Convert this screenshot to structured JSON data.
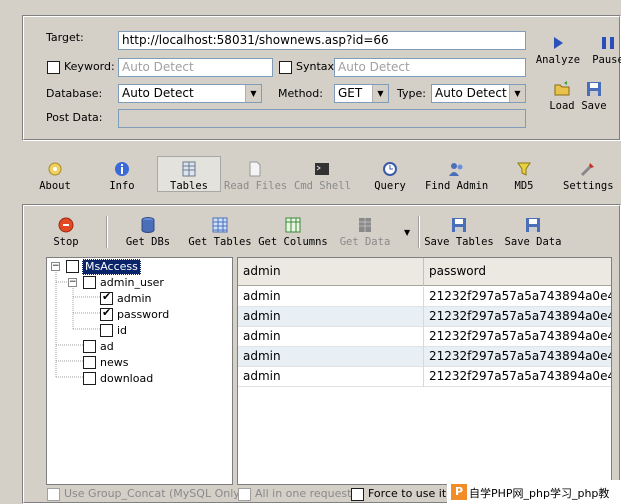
{
  "form": {
    "target_label": "Target:",
    "target_value": "http://localhost:58031/shownews.asp?id=66",
    "keyword_label": "Keyword:",
    "keyword_placeholder": "Auto Detect",
    "syntax_label": "Syntax:",
    "syntax_placeholder": "Auto Detect",
    "database_label": "Database:",
    "database_value": "Auto Detect",
    "method_label": "Method:",
    "method_value": "GET",
    "type_label": "Type:",
    "type_value": "Auto Detect",
    "postdata_label": "Post Data:"
  },
  "side_actions": {
    "analyze": "Analyze",
    "pause": "Pause",
    "load": "Load",
    "save": "Save"
  },
  "main_toolbar": [
    {
      "label": "About",
      "icon": "about-icon",
      "state": "normal"
    },
    {
      "label": "Info",
      "icon": "info-icon",
      "state": "normal"
    },
    {
      "label": "Tables",
      "icon": "tables-icon",
      "state": "active"
    },
    {
      "label": "Read Files",
      "icon": "read-files-icon",
      "state": "disabled"
    },
    {
      "label": "Cmd Shell",
      "icon": "cmd-shell-icon",
      "state": "disabled"
    },
    {
      "label": "Query",
      "icon": "query-icon",
      "state": "normal"
    },
    {
      "label": "Find Admin",
      "icon": "find-admin-icon",
      "state": "normal"
    },
    {
      "label": "MD5",
      "icon": "md5-icon",
      "state": "normal"
    },
    {
      "label": "Settings",
      "icon": "settings-icon",
      "state": "normal"
    }
  ],
  "sub_toolbar": {
    "stop": "Stop",
    "get_dbs": "Get DBs",
    "get_tables": "Get Tables",
    "get_columns": "Get Columns",
    "get_data": "Get Data",
    "save_tables": "Save Tables",
    "save_data": "Save Data"
  },
  "tree": {
    "root": "MsAccess",
    "table": "admin_user",
    "columns": [
      {
        "name": "admin",
        "checked": true
      },
      {
        "name": "password",
        "checked": true
      },
      {
        "name": "id",
        "checked": false
      }
    ],
    "other_tables": [
      "ad",
      "news",
      "download"
    ]
  },
  "grid": {
    "columns": [
      "admin",
      "password"
    ],
    "rows": [
      [
        "admin",
        "21232f297a57a5a743894a0e4..."
      ],
      [
        "admin",
        "21232f297a57a5a743894a0e4..."
      ],
      [
        "admin",
        "21232f297a57a5a743894a0e4..."
      ],
      [
        "admin",
        "21232f297a57a5a743894a0e4..."
      ],
      [
        "admin",
        "21232f297a57a5a743894a0e4..."
      ]
    ]
  },
  "footer": {
    "group_concat": "Use Group_Concat (MySQL Only)",
    "all_in_one": "All in one request.",
    "force": "Force to use it"
  },
  "watermark": "自学PHP网_php学习_php教"
}
